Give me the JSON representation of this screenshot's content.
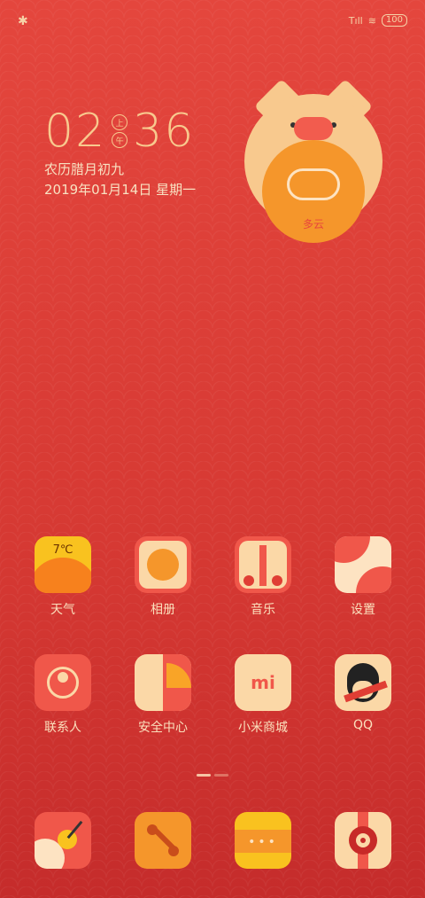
{
  "status_bar": {
    "bluetooth_icon": "bluetooth-icon",
    "signal": "Tıll",
    "battery": "100"
  },
  "clock": {
    "hour": "02",
    "minute": "36",
    "ampm_top": "上",
    "ampm_bottom": "午"
  },
  "lunar_date": "农历腊月初九",
  "date": "2019年01月14日  星期一",
  "weather_widget": {
    "condition": "多云"
  },
  "apps_row1": [
    {
      "label": "天气",
      "icon": "weather-icon",
      "temp": "7℃"
    },
    {
      "label": "相册",
      "icon": "gallery-icon"
    },
    {
      "label": "音乐",
      "icon": "music-icon"
    },
    {
      "label": "设置",
      "icon": "settings-icon"
    }
  ],
  "apps_row2": [
    {
      "label": "联系人",
      "icon": "contacts-icon"
    },
    {
      "label": "安全中心",
      "icon": "security-icon"
    },
    {
      "label": "小米商城",
      "icon": "mi-store-icon",
      "mark": "mi"
    },
    {
      "label": "QQ",
      "icon": "qq-icon"
    }
  ],
  "dock": [
    {
      "icon": "browser-icon"
    },
    {
      "icon": "phone-icon"
    },
    {
      "icon": "messages-icon"
    },
    {
      "icon": "camera-icon"
    }
  ]
}
